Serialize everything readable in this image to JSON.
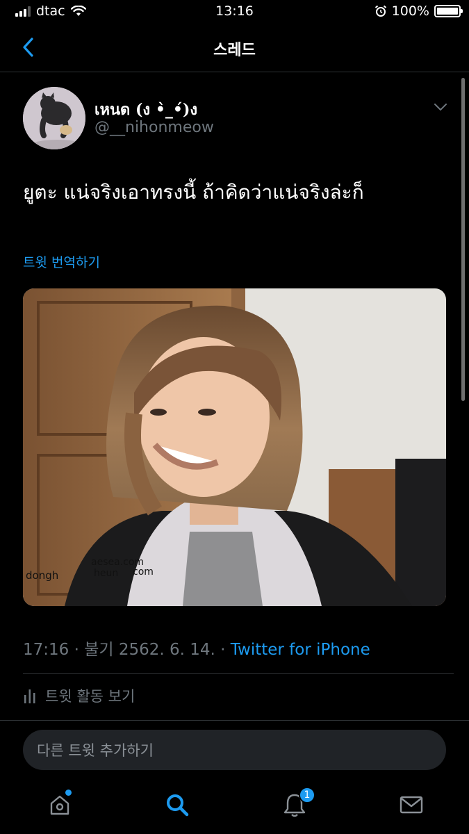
{
  "status_bar": {
    "carrier": "dtac",
    "time": "13:16",
    "battery": "100%",
    "battery_level": 1.0,
    "signal_bars": 3
  },
  "nav": {
    "title": "스레드"
  },
  "tweet": {
    "author_name": "เหนด (ง •̀_•́)ง",
    "author_handle": "@__nihonmeow",
    "text": "ยูตะ แน่จริงเอาทรงนี้ ถ้าคิดว่าแน่จริงล่ะก็",
    "translate_label": "트윗 번역하기",
    "media_watermark_1": "dongh",
    "media_watermark_2": "aesea.com",
    "media_watermark_3": "heun",
    "media_watermark_4": "com",
    "timestamp": "17:16 · 불기 2562. 6. 14. · ",
    "client": "Twitter for iPhone",
    "activity_label": "트윗 활동 보기"
  },
  "reply": {
    "placeholder": "다른 트윗 추가하기"
  },
  "tab_bar": {
    "notifications_count": "1"
  },
  "colors": {
    "accent": "#1d9bf0",
    "muted_text": "#6e767d",
    "divider": "#2f3336",
    "input_bg": "#202327"
  },
  "icons": [
    "back-chevron-icon",
    "caret-down-icon",
    "bar-chart-icon",
    "home-icon",
    "search-icon",
    "bell-icon",
    "mail-icon",
    "wifi-icon",
    "alarm-icon",
    "battery-icon"
  ]
}
